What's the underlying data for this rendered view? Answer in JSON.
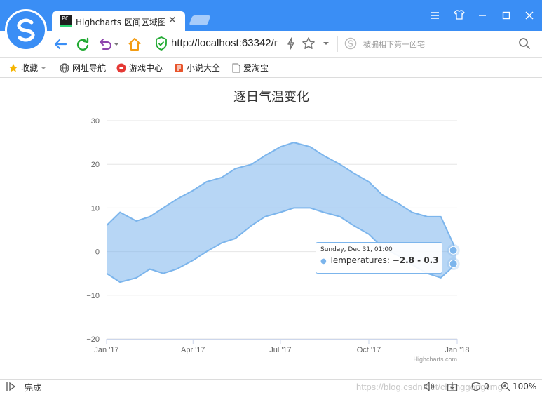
{
  "browser": {
    "tab_title": "Highcharts 区间区域图",
    "tab_favicon": "PC",
    "url_main": "http://localhost:63342/",
    "url_rest": "r",
    "search_placeholder": "被骗相下第一凶宅",
    "window_buttons": [
      "menu-icon",
      "skin-icon",
      "minimize-icon",
      "maximize-icon",
      "close-icon"
    ]
  },
  "bookmarks": [
    {
      "label": "收藏",
      "icon": "star-icon"
    },
    {
      "label": "网址导航",
      "icon": "globe-icon"
    },
    {
      "label": "游戏中心",
      "icon": "game-icon"
    },
    {
      "label": "小说大全",
      "icon": "book-icon"
    },
    {
      "label": "爱淘宝",
      "icon": "page-icon"
    }
  ],
  "status": {
    "text": "完成",
    "watermark": "https://blog.csdn.net/chenggongcmg",
    "counter": "0",
    "zoom": "100%"
  },
  "chart_data": {
    "type": "area",
    "title": "逐日气温变化",
    "credits": "Highcharts.com",
    "xlabel": "",
    "ylabel": "",
    "x_tick_labels": [
      "Jan '17",
      "Apr '17",
      "Jul '17",
      "Oct '17",
      "Jan '18"
    ],
    "y_ticks": [
      -20,
      -10,
      0,
      10,
      20,
      30
    ],
    "ylim": [
      -20,
      30
    ],
    "grid": true,
    "legend": "none",
    "color": "#7cb5ec",
    "series": [
      {
        "name": "Temperatures",
        "x": [
          "2017-01-01",
          "2017-01-15",
          "2017-02-01",
          "2017-02-15",
          "2017-03-01",
          "2017-03-15",
          "2017-04-01",
          "2017-04-15",
          "2017-05-01",
          "2017-05-15",
          "2017-06-01",
          "2017-06-15",
          "2017-07-01",
          "2017-07-15",
          "2017-08-01",
          "2017-08-15",
          "2017-09-01",
          "2017-09-15",
          "2017-10-01",
          "2017-10-15",
          "2017-11-01",
          "2017-11-15",
          "2017-12-01",
          "2017-12-15",
          "2017-12-31"
        ],
        "low": [
          -5,
          -7,
          -6,
          -4,
          -5,
          -4,
          -2,
          0,
          2,
          3,
          6,
          8,
          9,
          10,
          10,
          9,
          8,
          6,
          4,
          1,
          -1,
          -3,
          -5,
          -6,
          -2.8
        ],
        "high": [
          6,
          9,
          7,
          8,
          10,
          12,
          14,
          16,
          17,
          19,
          20,
          22,
          24,
          25,
          24,
          22,
          20,
          18,
          16,
          13,
          11,
          9,
          8,
          8,
          0.3
        ]
      }
    ],
    "tooltip": {
      "date": "Sunday, Dec 31, 01:00",
      "series_label": "Temperatures: ",
      "value": "−2.8 - 0.3"
    }
  }
}
